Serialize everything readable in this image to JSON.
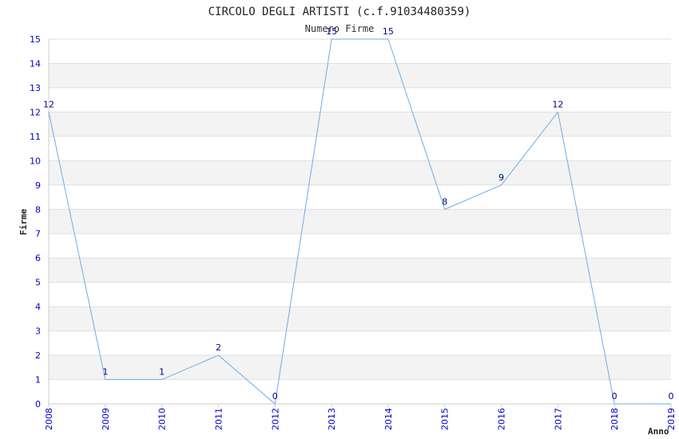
{
  "chart_data": {
    "type": "line",
    "title": "CIRCOLO DEGLI ARTISTI (c.f.91034480359)",
    "subtitle": "Numero Firme",
    "xlabel": "Anno",
    "ylabel": "Firme",
    "x": [
      "2008",
      "2009",
      "2010",
      "2011",
      "2012",
      "2013",
      "2014",
      "2015",
      "2016",
      "2017",
      "2018",
      "2019"
    ],
    "series": [
      {
        "values": [
          12,
          1,
          1,
          2,
          0,
          15,
          15,
          8,
          9,
          12,
          0,
          0
        ]
      }
    ],
    "ylim": [
      0,
      15
    ],
    "yticks": [
      0,
      1,
      2,
      3,
      4,
      5,
      6,
      7,
      8,
      9,
      10,
      11,
      12,
      13,
      14,
      15
    ],
    "grid": true,
    "line_color": "#6aaee8",
    "band_color": "#f3f3f3",
    "tick_color": "#0000cc",
    "label_color": "#000080"
  }
}
